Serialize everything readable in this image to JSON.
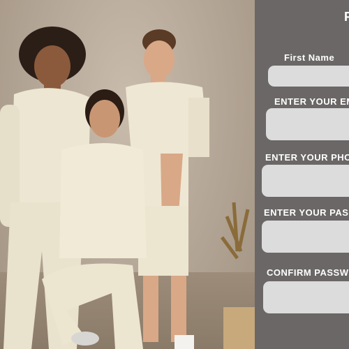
{
  "form": {
    "title_fragment": "F",
    "fields": [
      {
        "label": "First Name",
        "value": "",
        "placeholder": ""
      },
      {
        "label": "ENTER YOUR EM",
        "value": "",
        "placeholder": ""
      },
      {
        "label": "ENTER YOUR PHO",
        "value": "",
        "placeholder": ""
      },
      {
        "label": "ENTER YOUR PAS",
        "value": "",
        "placeholder": ""
      },
      {
        "label": "CONFIRM PASSW",
        "value": "",
        "placeholder": ""
      }
    ]
  },
  "colors": {
    "panel_bg": "#6a6766",
    "field_bg": "#dcdcdc",
    "label_text": "#ffffff"
  }
}
